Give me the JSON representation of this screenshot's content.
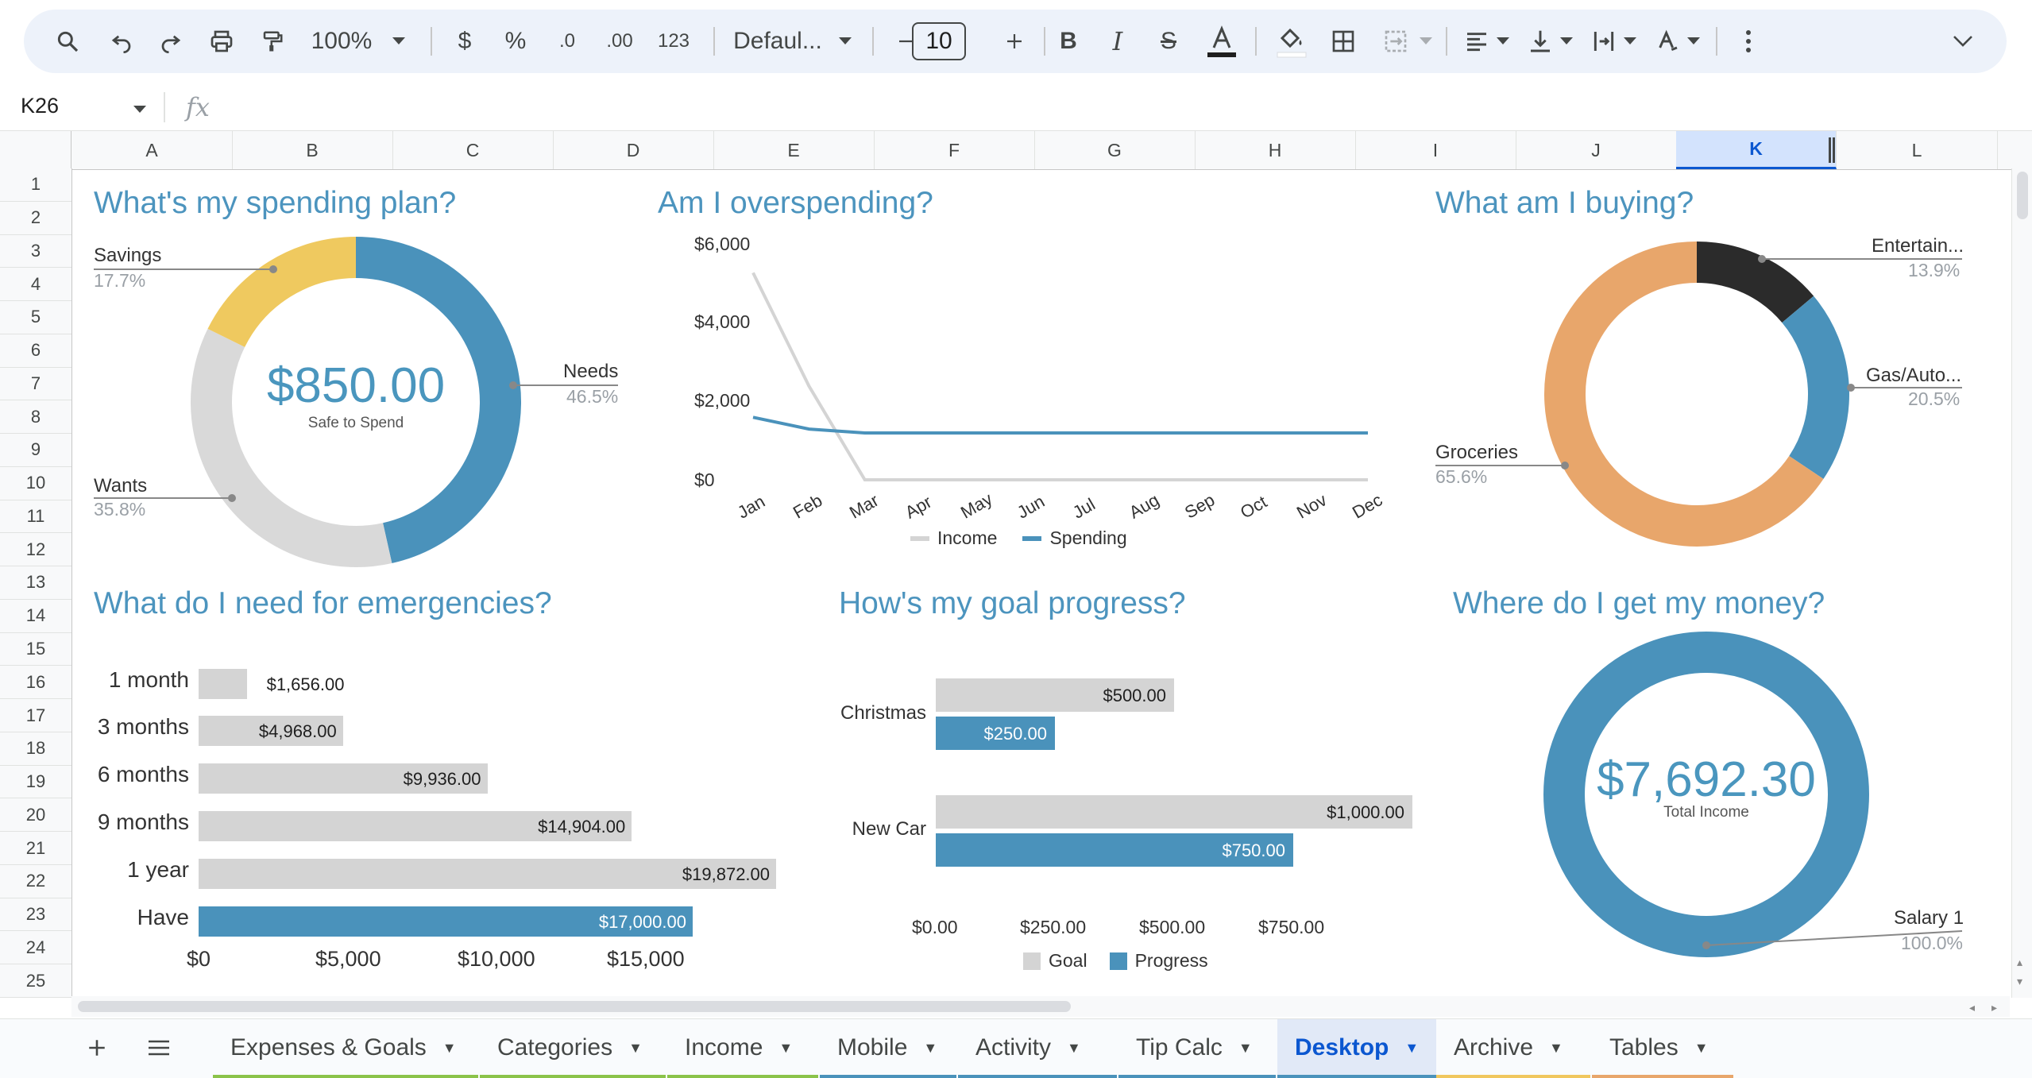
{
  "toolbar": {
    "zoom": "100%",
    "currency": "$",
    "percent": "%",
    "decrease_decimal": ".0",
    "increase_decimal": ".00",
    "number_format": "123",
    "font": "Defaul...",
    "font_size": "10"
  },
  "formula_bar": {
    "cell_ref": "K26",
    "fx": "fx"
  },
  "columns": [
    "A",
    "B",
    "C",
    "D",
    "E",
    "F",
    "G",
    "H",
    "I",
    "J",
    "K",
    "L"
  ],
  "selected_column": "K",
  "rows": [
    "1",
    "2",
    "3",
    "4",
    "5",
    "6",
    "7",
    "8",
    "9",
    "10",
    "11",
    "12",
    "13",
    "14",
    "15",
    "16",
    "17",
    "18",
    "19",
    "20",
    "21",
    "22",
    "23",
    "24",
    "25"
  ],
  "charts": {
    "spending_plan": {
      "title": "What's my spending plan?",
      "center_value": "$850.00",
      "center_label": "Safe to Spend",
      "labels": [
        {
          "name": "Savings",
          "pct": "17.7%"
        },
        {
          "name": "Needs",
          "pct": "46.5%"
        },
        {
          "name": "Wants",
          "pct": "35.8%"
        }
      ]
    },
    "overspending": {
      "title": "Am I overspending?",
      "y_ticks": [
        "$6,000",
        "$4,000",
        "$2,000",
        "$0"
      ],
      "legend_income": "Income",
      "legend_spending": "Spending"
    },
    "buying": {
      "title": "What am I buying?",
      "labels": [
        {
          "name": "Entertain...",
          "pct": "13.9%"
        },
        {
          "name": "Gas/Auto...",
          "pct": "20.5%"
        },
        {
          "name": "Groceries",
          "pct": "65.6%"
        }
      ]
    },
    "emergencies": {
      "title": "What do I need for emergencies?",
      "x_ticks": [
        "$0",
        "$5,000",
        "$10,000",
        "$15,000"
      ]
    },
    "goal_progress": {
      "title": "How's my goal progress?",
      "x_ticks": [
        "$0.00",
        "$250.00",
        "$500.00",
        "$750.00"
      ],
      "legend_goal": "Goal",
      "legend_progress": "Progress"
    },
    "money_source": {
      "title": "Where do I get my money?",
      "center_value": "$7,692.30",
      "center_label": "Total Income",
      "label": "Salary 1",
      "pct": "100.0%"
    }
  },
  "chart_data": [
    {
      "type": "pie",
      "title": "What's my spending plan?",
      "categories": [
        "Needs",
        "Wants",
        "Savings"
      ],
      "values": [
        46.5,
        35.8,
        17.7
      ],
      "colors": [
        "#4a92bb",
        "#d9d9d9",
        "#efc95f"
      ]
    },
    {
      "type": "line",
      "title": "Am I overspending?",
      "x": [
        "Jan",
        "Feb",
        "Mar",
        "Apr",
        "May",
        "Jun",
        "Jul",
        "Aug",
        "Sep",
        "Oct",
        "Nov",
        "Dec"
      ],
      "ylim": [
        0,
        6000
      ],
      "series": [
        {
          "name": "Income",
          "color": "#d4d4d4",
          "values": [
            5300,
            2400,
            0,
            0,
            0,
            0,
            0,
            0,
            0,
            0,
            0,
            0
          ]
        },
        {
          "name": "Spending",
          "color": "#4a92bb",
          "values": [
            1600,
            1300,
            1200,
            1200,
            1200,
            1200,
            1200,
            1200,
            1200,
            1200,
            1200,
            1200
          ]
        }
      ]
    },
    {
      "type": "pie",
      "title": "What am I buying?",
      "categories": [
        "Entertain...",
        "Gas/Auto...",
        "Groceries"
      ],
      "values": [
        13.9,
        20.5,
        65.6
      ],
      "colors": [
        "#2b2b2b",
        "#4a92bb",
        "#e8a66b"
      ]
    },
    {
      "type": "bar",
      "title": "What do I need for emergencies?",
      "categories": [
        "1 month",
        "3 months",
        "6 months",
        "9 months",
        "1 year",
        "Have"
      ],
      "values": [
        1656,
        4968,
        9936,
        14904,
        19872,
        17000
      ],
      "value_labels": [
        "$1,656.00",
        "$4,968.00",
        "$9,936.00",
        "$14,904.00",
        "$19,872.00",
        "$17,000.00"
      ],
      "xlim": [
        0,
        20000
      ]
    },
    {
      "type": "bar",
      "title": "How's my goal progress?",
      "categories": [
        "Christmas",
        "New Car"
      ],
      "series": [
        {
          "name": "Goal",
          "values": [
            500,
            1000
          ],
          "labels": [
            "$500.00",
            "$1,000.00"
          ]
        },
        {
          "name": "Progress",
          "values": [
            250,
            750
          ],
          "labels": [
            "$250.00",
            "$750.00"
          ]
        }
      ],
      "xlim": [
        0,
        1000
      ]
    },
    {
      "type": "pie",
      "title": "Where do I get my money?",
      "categories": [
        "Salary 1"
      ],
      "values": [
        100.0
      ],
      "colors": [
        "#4a92bb"
      ]
    }
  ],
  "tabs": [
    {
      "label": "Expenses & Goals",
      "color": "#8bc34a"
    },
    {
      "label": "Categories",
      "color": "#8bc34a"
    },
    {
      "label": "Income",
      "color": "#8bc34a"
    },
    {
      "label": "Mobile",
      "color": "#4a92bb"
    },
    {
      "label": "Activity",
      "color": "#4a92bb"
    },
    {
      "label": "Tip Calc",
      "color": "#4a92bb"
    },
    {
      "label": "Desktop",
      "color": "#4a92bb"
    },
    {
      "label": "Archive",
      "color": "#f0c75e"
    },
    {
      "label": "Tables",
      "color": "#e8a66b"
    }
  ],
  "active_tab": "Desktop"
}
